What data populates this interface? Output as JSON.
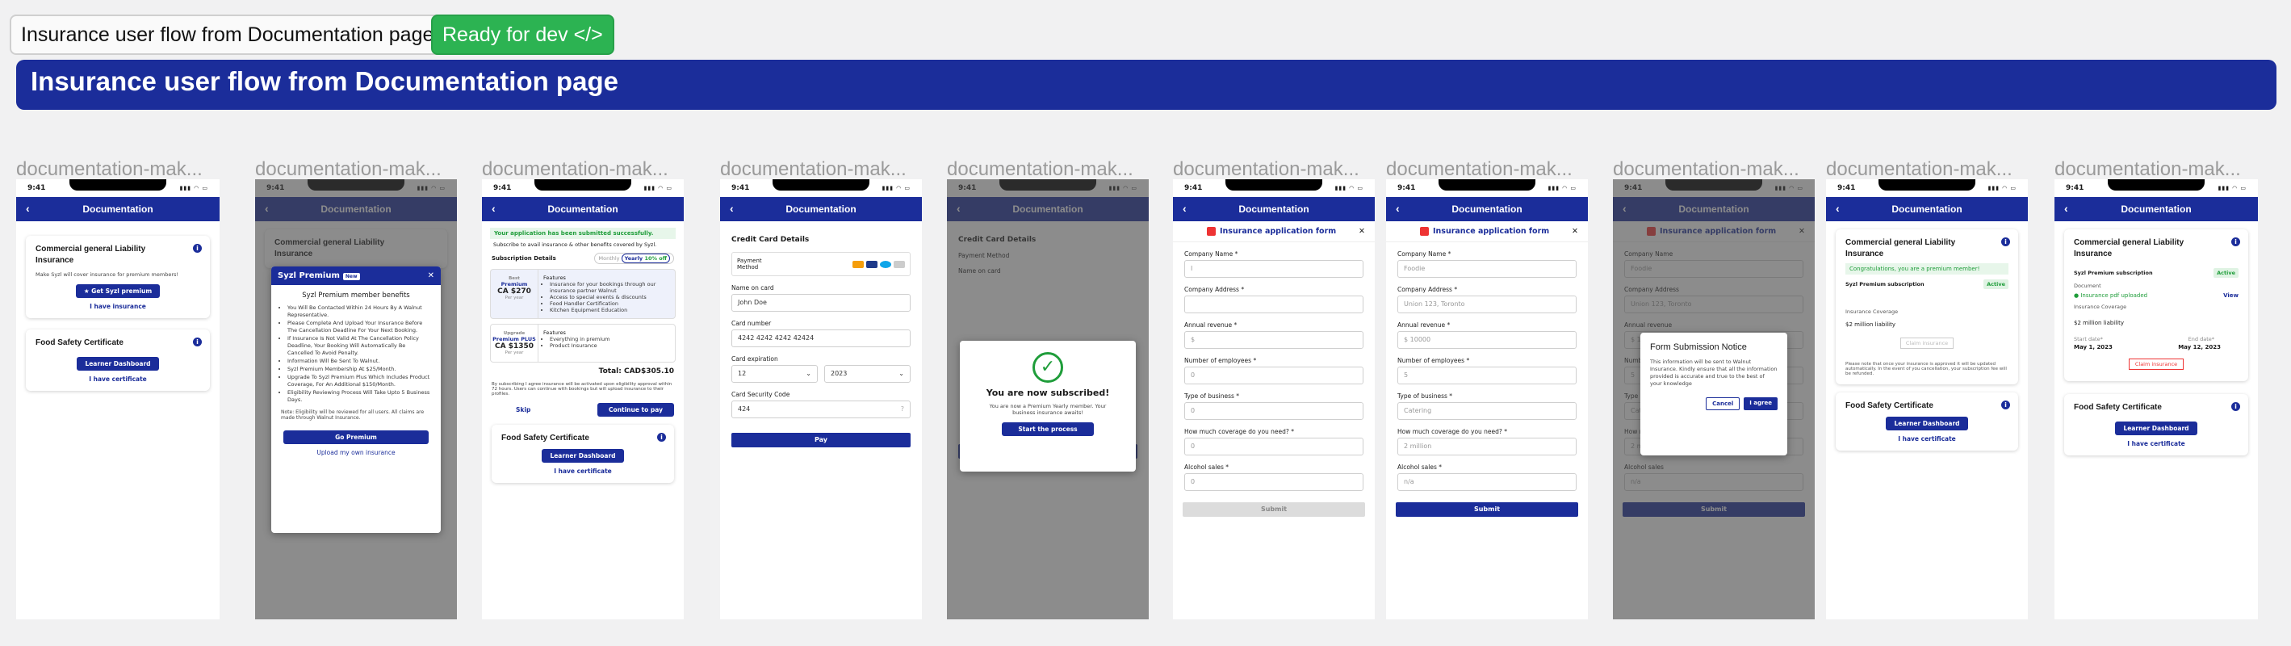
{
  "header": {
    "chip_title": "Insurance user flow from Documentation page",
    "chip_status": "Ready for dev",
    "banner_title": "Insurance user flow from Documentation page"
  },
  "frame_label": "documentation-mak...",
  "status_time": "9:41",
  "nav_title": "Documentation",
  "cards": {
    "cgl_title": "Commercial general Liability Insurance",
    "cgl_note": "Make Syzl will cover insurance for premium members!",
    "get_premium": "Get Syzl premium",
    "have_insurance": "I have insurance",
    "food_title": "Food Safety Certificate",
    "learner_dashboard": "Learner Dashboard",
    "have_certificate": "I have certificate"
  },
  "premium_modal": {
    "title": "Syzl Premium",
    "new_badge": "New",
    "subtitle": "Syzl Premium member benefits",
    "bullets": [
      "You Will Be Contacted Within 24 Hours By A Walnut Representative.",
      "Please Complete And Upload Your Insurance Before The Cancellation Deadline For Your Next Booking.",
      "If Insurance Is Not Valid At The Cancellation Policy Deadline, Your Booking Will Automatically Be Cancelled To Avoid Penalty.",
      "Information Will Be Sent To Walnut.",
      "Syzl Premium Membership At $25/Month.",
      "Upgrade To Syzl Premium Plus Which Includes Product Coverage, For An Additional $150/Month.",
      "Eligibility Reviewing Process Will Take Upto 5 Business Days."
    ],
    "note": "Note: Eligibility will be reviewed for all users. All claims are made through Walnut Insurance.",
    "go_premium": "Go Premium",
    "upload": "Upload my own insurance"
  },
  "subscription": {
    "success": "Your application has been submitted successfully.",
    "subscribe_line": "Subscribe to avail insurance & other benefits covered by Syzl.",
    "details_label": "Subscription Details",
    "monthly": "Monthly",
    "yearly": "Yearly",
    "discount": "10% off",
    "plan1_tag": "Best",
    "plan1_name": "Premium",
    "plan1_price": "CA $270",
    "plan1_per": "Per year",
    "plan1_features": [
      "Insurance for your bookings through our insurance partner Walnut",
      "Access to special events & discounts",
      "Food Handler Certification",
      "Kitchen Equipment Education"
    ],
    "plan2_tag": "Upgrade",
    "plan2_name": "Premium PLUS",
    "plan2_price": "CA $1350",
    "plan2_per": "Per year",
    "plan2_features": [
      "Everything in premium",
      "Product Insurance"
    ],
    "features_label": "Features",
    "total": "Total: CAD$305.10",
    "terms": "By subscribing I agree insurance will be activated upon eligibility approval within 72 hours. Users can continue with bookings but will upload insurance to their profiles.",
    "skip": "Skip",
    "continue": "Continue to pay"
  },
  "payment": {
    "title": "Credit Card Details",
    "method_label": "Payment Method",
    "name_label": "Name on card",
    "name_value": "John Doe",
    "number_label": "Card number",
    "number_value": "4242 4242 4242 42424",
    "exp_label": "Card expiration",
    "month": "12",
    "year": "2023",
    "cvv_label": "Card Security Code",
    "cvv_value": "424",
    "pay": "Pay"
  },
  "subscribed": {
    "title": "You are now subscribed!",
    "text": "You are now a Premium Yearly member. Your business insurance awaits!",
    "start": "Start the process"
  },
  "form": {
    "title": "Insurance application form",
    "fields": [
      {
        "label": "Company Name",
        "placeholder": "I",
        "filled": "Foodie"
      },
      {
        "label": "Company Address",
        "placeholder": "",
        "filled": "Union 123, Toronto"
      },
      {
        "label": "Annual revenue",
        "placeholder": "$",
        "filled": "$ 10000"
      },
      {
        "label": "Number of employees",
        "placeholder": "0",
        "filled": "5"
      },
      {
        "label": "Type of business",
        "placeholder": "0",
        "filled": "Catering"
      },
      {
        "label": "How much coverage do you need?",
        "placeholder": "0",
        "filled": "2 million"
      },
      {
        "label": "Alcohol sales",
        "placeholder": "0",
        "filled": "n/a"
      }
    ],
    "submit": "Submit"
  },
  "notice": {
    "title": "Form Submission Notice",
    "text": "This information will be sent to Walnut Insurance. Kindly ensure that all the information provided is accurate and true to the best of your knowledge",
    "cancel": "Cancel",
    "agree": "I agree"
  },
  "premium_state": {
    "congrats": "Congratulations, you are a premium member!",
    "sub_label": "Syzl Premium subscription",
    "active": "Active",
    "coverage_label": "Insurance Coverage",
    "coverage": "$2 million liability",
    "claim": "Claim insurance",
    "note": "Please note that once your insurance is approved it will be updated automatically. In the event of you cancellation, your subscription fee will be refunded.",
    "doc_label": "Document",
    "doc": "Insurance pdf uploaded",
    "view": "View",
    "start_label": "Start date*",
    "start": "May 1, 2023",
    "end_label": "End date*",
    "end": "May 12, 2023"
  }
}
